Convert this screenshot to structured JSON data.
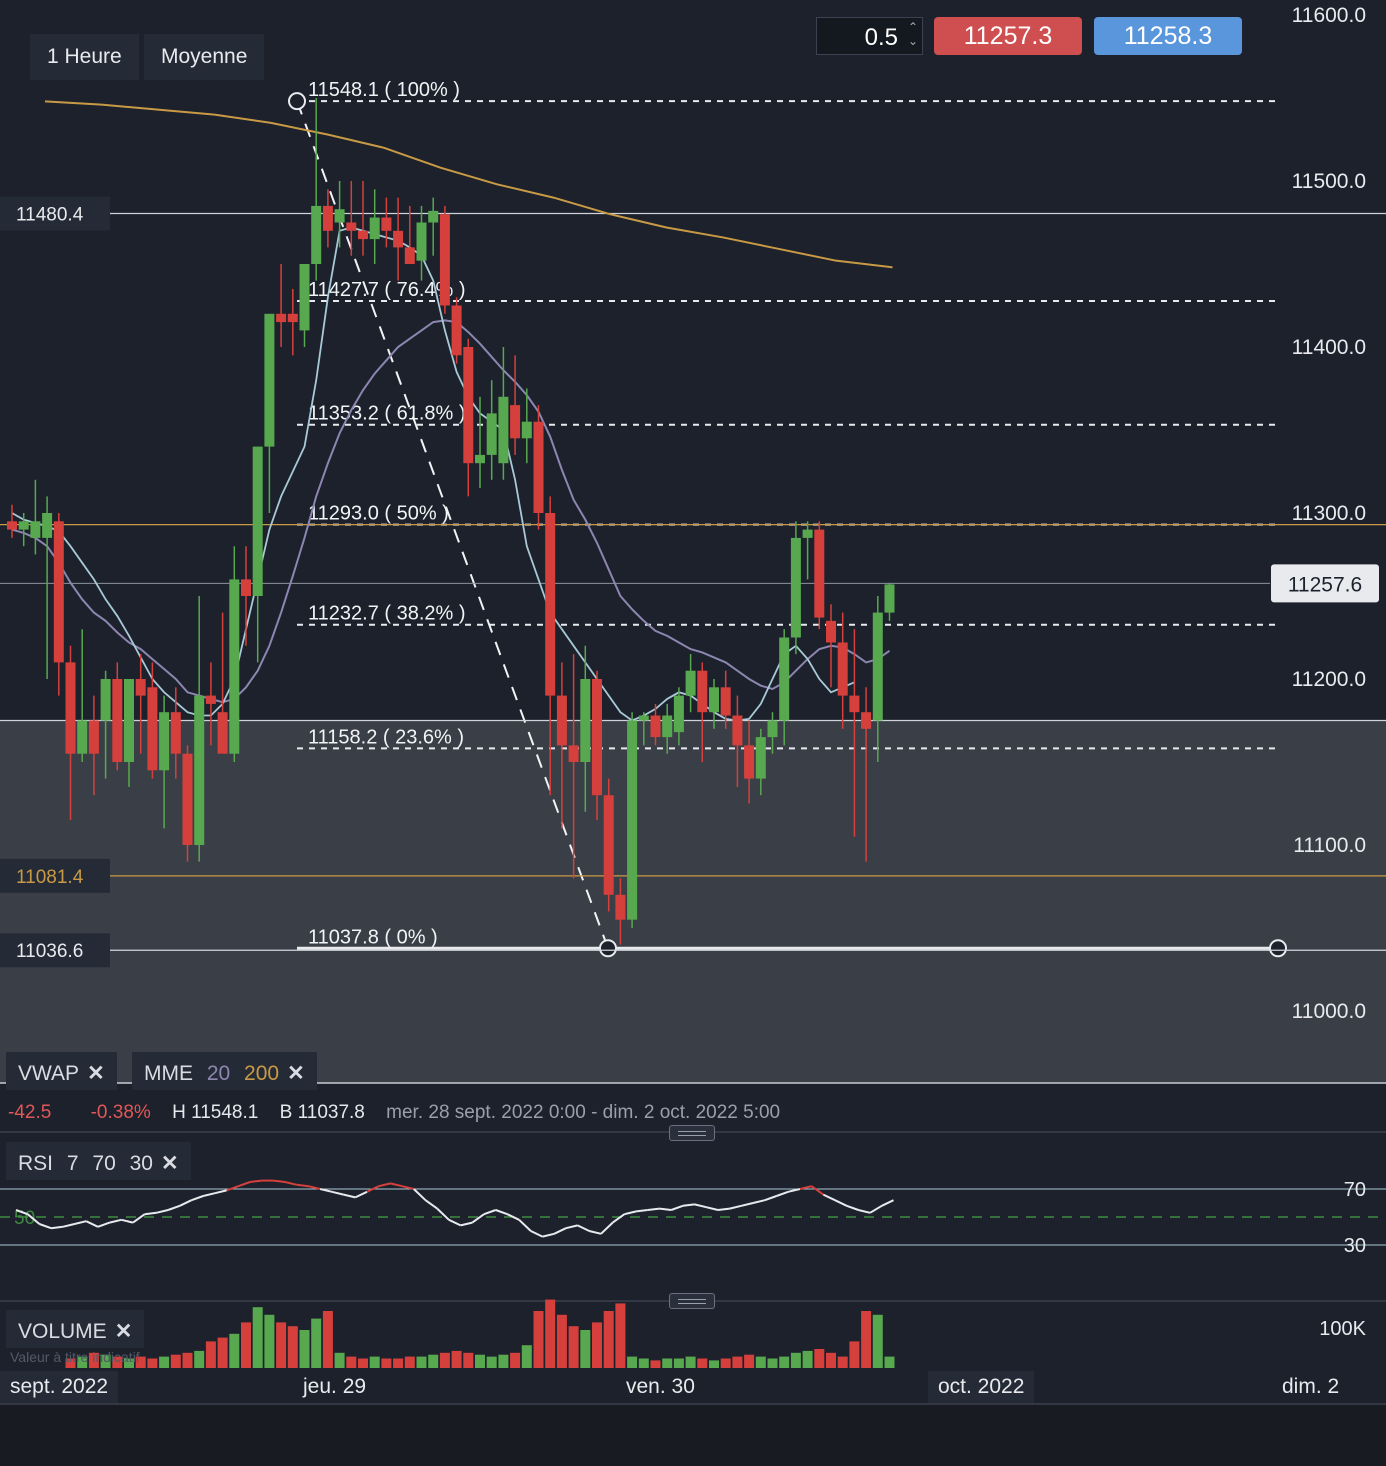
{
  "toolbar": {
    "timeframe": "1 Heure",
    "chart_type": "Moyenne",
    "quantity": "0.5",
    "sell_price": "11257.3",
    "buy_price": "11258.3"
  },
  "indicators": {
    "vwap_label": "VWAP",
    "mme_label": "MME",
    "mme_fast": "20",
    "mme_slow": "200",
    "rsi_label": "RSI",
    "rsi_period": "7",
    "rsi_upper": "70",
    "rsi_lower": "30",
    "volume_label": "VOLUME",
    "volume_note": "Valeur à titre indicatif",
    "close_symbol": "✕"
  },
  "stats": {
    "change": "-42.5",
    "change_pct": "-0.38%",
    "high": "H 11548.1",
    "low": "B 11037.8",
    "range": "mer. 28 sept. 2022 0:00 - dim. 2 oct. 2022 5:00"
  },
  "colors": {
    "background": "#1c212c",
    "up": "#57a84f",
    "down": "#d5403d",
    "mme20": "#8d86b0",
    "mme200": "#c99a45",
    "vwap": "#a8c9d6",
    "sell": "#cf4e4f",
    "buy": "#5a96dc"
  },
  "chart_data": {
    "type": "candlestick",
    "y_axis": {
      "ticks": [
        "11600.0",
        "11500.0",
        "11400.0",
        "11300.0",
        "11200.0",
        "11100.0",
        "11000.0"
      ],
      "tick_values": [
        11600,
        11500,
        11400,
        11300,
        11200,
        11100,
        11000
      ]
    },
    "x_axis": {
      "labels": [
        "sept. 2022",
        "jeu. 29",
        "ven. 30",
        "oct. 2022",
        "dim. 2"
      ]
    },
    "current_price": "11257.6",
    "current_price_value": 11257.6,
    "horizontal_lines": [
      {
        "label": "11480.4",
        "value": 11480.4,
        "color": "#d0d4da"
      },
      {
        "label": "11081.4",
        "value": 11081.4,
        "color": "#c99a45"
      },
      {
        "label": "11036.6",
        "value": 11036.6,
        "color": "#d0d4da"
      },
      {
        "label": "",
        "value": 11293,
        "color": "#c99a45"
      },
      {
        "label": "",
        "value": 11175,
        "color": "#d0d4da"
      }
    ],
    "fibonacci": [
      {
        "label": "11548.1 ( 100% )",
        "value": 11548.1
      },
      {
        "label": "11427.7 ( 76.4% )",
        "value": 11427.7
      },
      {
        "label": "11353.2 ( 61.8% )",
        "value": 11353.2
      },
      {
        "label": "11293.0 ( 50% )",
        "value": 11293.0
      },
      {
        "label": "11232.7 ( 38.2% )",
        "value": 11232.7
      },
      {
        "label": "11158.2 ( 23.6% )",
        "value": 11158.2
      },
      {
        "label": "11037.8 ( 0% )",
        "value": 11037.8
      }
    ],
    "candles": [
      {
        "o": 11295,
        "h": 11305,
        "l": 11285,
        "c": 11290
      },
      {
        "o": 11290,
        "h": 11300,
        "l": 11280,
        "c": 11295
      },
      {
        "o": 11285,
        "h": 11320,
        "l": 11275,
        "c": 11295
      },
      {
        "o": 11285,
        "h": 11310,
        "l": 11200,
        "c": 11300
      },
      {
        "o": 11295,
        "h": 11300,
        "l": 11190,
        "c": 11210
      },
      {
        "o": 11210,
        "h": 11220,
        "l": 11115,
        "c": 11155
      },
      {
        "o": 11155,
        "h": 11230,
        "l": 11150,
        "c": 11175
      },
      {
        "o": 11175,
        "h": 11190,
        "l": 11130,
        "c": 11155
      },
      {
        "o": 11175,
        "h": 11205,
        "l": 11140,
        "c": 11200
      },
      {
        "o": 11200,
        "h": 11210,
        "l": 11145,
        "c": 11150
      },
      {
        "o": 11150,
        "h": 11200,
        "l": 11135,
        "c": 11200
      },
      {
        "o": 11200,
        "h": 11215,
        "l": 11155,
        "c": 11190
      },
      {
        "o": 11195,
        "h": 11210,
        "l": 11140,
        "c": 11145
      },
      {
        "o": 11145,
        "h": 11190,
        "l": 11110,
        "c": 11180
      },
      {
        "o": 11180,
        "h": 11195,
        "l": 11140,
        "c": 11155
      },
      {
        "o": 11155,
        "h": 11160,
        "l": 11090,
        "c": 11100
      },
      {
        "o": 11100,
        "h": 11250,
        "l": 11090,
        "c": 11190
      },
      {
        "o": 11190,
        "h": 11210,
        "l": 11160,
        "c": 11185
      },
      {
        "o": 11180,
        "h": 11240,
        "l": 11160,
        "c": 11155
      },
      {
        "o": 11155,
        "h": 11280,
        "l": 11150,
        "c": 11260
      },
      {
        "o": 11260,
        "h": 11280,
        "l": 11220,
        "c": 11250
      },
      {
        "o": 11250,
        "h": 11300,
        "l": 11210,
        "c": 11340
      },
      {
        "o": 11340,
        "h": 11360,
        "l": 11300,
        "c": 11420
      },
      {
        "o": 11420,
        "h": 11450,
        "l": 11400,
        "c": 11415
      },
      {
        "o": 11420,
        "h": 11435,
        "l": 11395,
        "c": 11415
      },
      {
        "o": 11410,
        "h": 11430,
        "l": 11400,
        "c": 11450
      },
      {
        "o": 11450,
        "h": 11550,
        "l": 11440,
        "c": 11485
      },
      {
        "o": 11485,
        "h": 11495,
        "l": 11460,
        "c": 11470
      },
      {
        "o": 11475,
        "h": 11500,
        "l": 11460,
        "c": 11483
      },
      {
        "o": 11475,
        "h": 11500,
        "l": 11455,
        "c": 11470
      },
      {
        "o": 11470,
        "h": 11500,
        "l": 11455,
        "c": 11465
      },
      {
        "o": 11465,
        "h": 11495,
        "l": 11450,
        "c": 11478
      },
      {
        "o": 11478,
        "h": 11490,
        "l": 11460,
        "c": 11470
      },
      {
        "o": 11470,
        "h": 11490,
        "l": 11440,
        "c": 11460
      },
      {
        "o": 11460,
        "h": 11485,
        "l": 11450,
        "c": 11450
      },
      {
        "o": 11452,
        "h": 11485,
        "l": 11440,
        "c": 11475
      },
      {
        "o": 11475,
        "h": 11490,
        "l": 11455,
        "c": 11482
      },
      {
        "o": 11480,
        "h": 11485,
        "l": 11420,
        "c": 11425
      },
      {
        "o": 11425,
        "h": 11430,
        "l": 11390,
        "c": 11395
      },
      {
        "o": 11400,
        "h": 11405,
        "l": 11310,
        "c": 11330
      },
      {
        "o": 11330,
        "h": 11370,
        "l": 11315,
        "c": 11335
      },
      {
        "o": 11335,
        "h": 11380,
        "l": 11320,
        "c": 11360
      },
      {
        "o": 11330,
        "h": 11400,
        "l": 11320,
        "c": 11370
      },
      {
        "o": 11365,
        "h": 11395,
        "l": 11335,
        "c": 11345
      },
      {
        "o": 11345,
        "h": 11375,
        "l": 11330,
        "c": 11355
      },
      {
        "o": 11355,
        "h": 11365,
        "l": 11290,
        "c": 11300
      },
      {
        "o": 11300,
        "h": 11310,
        "l": 11130,
        "c": 11190
      },
      {
        "o": 11190,
        "h": 11210,
        "l": 11110,
        "c": 11160
      },
      {
        "o": 11160,
        "h": 11215,
        "l": 11080,
        "c": 11150
      },
      {
        "o": 11150,
        "h": 11220,
        "l": 11120,
        "c": 11200
      },
      {
        "o": 11200,
        "h": 11205,
        "l": 11115,
        "c": 11130
      },
      {
        "o": 11130,
        "h": 11140,
        "l": 11060,
        "c": 11070
      },
      {
        "o": 11070,
        "h": 11080,
        "l": 11040,
        "c": 11055
      },
      {
        "o": 11055,
        "h": 11180,
        "l": 11050,
        "c": 11175
      },
      {
        "o": 11175,
        "h": 11180,
        "l": 11160,
        "c": 11178
      },
      {
        "o": 11178,
        "h": 11185,
        "l": 11160,
        "c": 11165
      },
      {
        "o": 11165,
        "h": 11185,
        "l": 11155,
        "c": 11178
      },
      {
        "o": 11168,
        "h": 11195,
        "l": 11160,
        "c": 11190
      },
      {
        "o": 11190,
        "h": 11215,
        "l": 11180,
        "c": 11205
      },
      {
        "o": 11205,
        "h": 11210,
        "l": 11150,
        "c": 11180
      },
      {
        "o": 11180,
        "h": 11200,
        "l": 11170,
        "c": 11195
      },
      {
        "o": 11195,
        "h": 11205,
        "l": 11170,
        "c": 11178
      },
      {
        "o": 11178,
        "h": 11190,
        "l": 11135,
        "c": 11160
      },
      {
        "o": 11160,
        "h": 11175,
        "l": 11125,
        "c": 11140
      },
      {
        "o": 11140,
        "h": 11170,
        "l": 11130,
        "c": 11165
      },
      {
        "o": 11165,
        "h": 11180,
        "l": 11155,
        "c": 11175
      },
      {
        "o": 11175,
        "h": 11230,
        "l": 11160,
        "c": 11225
      },
      {
        "o": 11225,
        "h": 11295,
        "l": 11215,
        "c": 11285
      },
      {
        "o": 11285,
        "h": 11295,
        "l": 11260,
        "c": 11290
      },
      {
        "o": 11290,
        "h": 11295,
        "l": 11230,
        "c": 11237
      },
      {
        "o": 11235,
        "h": 11245,
        "l": 11195,
        "c": 11222
      },
      {
        "o": 11222,
        "h": 11240,
        "l": 11170,
        "c": 11190
      },
      {
        "o": 11190,
        "h": 11230,
        "l": 11105,
        "c": 11180
      },
      {
        "o": 11180,
        "h": 11195,
        "l": 11090,
        "c": 11170
      },
      {
        "o": 11175,
        "h": 11250,
        "l": 11150,
        "c": 11240
      },
      {
        "o": 11240,
        "h": 11258,
        "l": 11235,
        "c": 11257
      }
    ],
    "mme20": [
      11290,
      11288,
      11285,
      11280,
      11270,
      11258,
      11248,
      11240,
      11235,
      11228,
      11222,
      11218,
      11212,
      11206,
      11200,
      11192,
      11190,
      11188,
      11186,
      11188,
      11195,
      11205,
      11220,
      11240,
      11262,
      11285,
      11310,
      11330,
      11348,
      11362,
      11374,
      11384,
      11392,
      11400,
      11405,
      11410,
      11415,
      11416,
      11415,
      11409,
      11402,
      11394,
      11386,
      11379,
      11371,
      11361,
      11346,
      11326,
      11308,
      11296,
      11282,
      11266,
      11250,
      11242,
      11235,
      11229,
      11226,
      11222,
      11218,
      11216,
      11213,
      11210,
      11205,
      11200,
      11196,
      11194,
      11198,
      11205,
      11212,
      11218,
      11220,
      11219,
      11215,
      11210,
      11212,
      11217
    ],
    "mme200": [
      11548,
      11546,
      11543,
      11540,
      11535,
      11528,
      11520,
      11508,
      11498,
      11490,
      11480,
      11472,
      11466,
      11459,
      11452,
      11448
    ],
    "vwap": [
      11300,
      11296,
      11294,
      11292,
      11289,
      11280,
      11270,
      11260,
      11248,
      11238,
      11226,
      11213,
      11200,
      11192,
      11186,
      11180,
      11178,
      11178,
      11185,
      11200,
      11230,
      11260,
      11290,
      11310,
      11325,
      11340,
      11380,
      11430,
      11470,
      11472,
      11470,
      11468,
      11466,
      11464,
      11460,
      11455,
      11440,
      11410,
      11385,
      11370,
      11360,
      11355,
      11350,
      11320,
      11280,
      11260,
      11240,
      11230,
      11220,
      11210,
      11200,
      11190,
      11180,
      11175,
      11178,
      11182,
      11188,
      11192,
      11190,
      11185,
      11180,
      11176,
      11175,
      11176,
      11185,
      11200,
      11215,
      11220,
      11212,
      11200,
      11192,
      11195,
      11198
    ],
    "rsi": [
      55,
      52,
      45,
      42,
      43,
      45,
      47,
      43,
      46,
      48,
      46,
      52,
      53,
      55,
      58,
      62,
      65,
      67,
      69,
      72,
      75,
      76,
      76,
      75,
      73,
      72,
      70,
      68,
      66,
      64,
      68,
      72,
      74,
      72,
      70,
      62,
      56,
      48,
      44,
      46,
      52,
      55,
      52,
      48,
      40,
      36,
      38,
      42,
      44,
      40,
      38,
      46,
      52,
      54,
      55,
      56,
      55,
      58,
      59,
      57,
      55,
      56,
      58,
      60,
      62,
      65,
      68,
      70,
      72,
      66,
      62,
      58,
      55,
      53,
      58,
      62
    ],
    "volume": [
      5,
      6,
      8,
      7,
      6,
      5,
      6,
      5,
      6,
      7,
      8,
      9,
      14,
      16,
      18,
      24,
      32,
      28,
      24,
      22,
      20,
      26,
      30,
      8,
      6,
      5,
      6,
      5,
      5,
      6,
      6,
      7,
      8,
      9,
      8,
      7,
      6,
      7,
      8,
      12,
      30,
      36,
      28,
      22,
      20,
      24,
      30,
      34,
      6,
      5,
      4,
      5,
      5,
      6,
      5,
      4,
      5,
      6,
      7,
      6,
      5,
      6,
      8,
      9,
      10,
      8,
      6,
      14,
      30,
      28,
      6
    ]
  }
}
